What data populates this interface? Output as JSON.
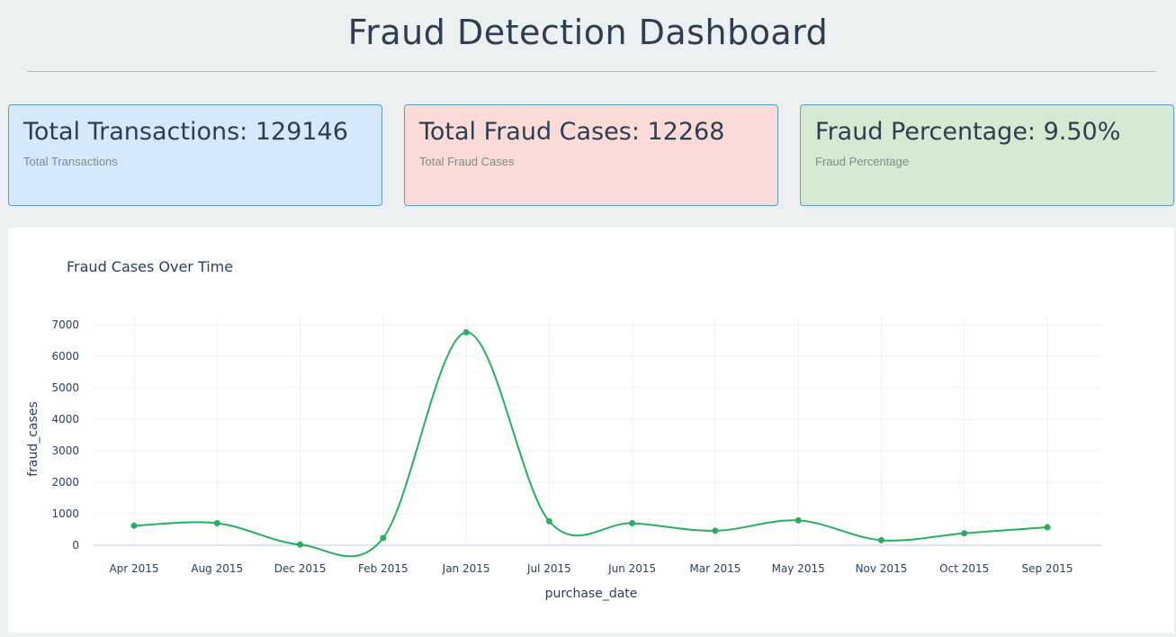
{
  "header": {
    "title": "Fraud Detection Dashboard"
  },
  "cards": [
    {
      "value_text": "Total Transactions: 129146",
      "subtitle": "Total Transactions"
    },
    {
      "value_text": "Total Fraud Cases: 12268",
      "subtitle": "Total Fraud Cases"
    },
    {
      "value_text": "Fraud Percentage: 9.50%",
      "subtitle": "Fraud Percentage"
    }
  ],
  "colors": {
    "line": "#27ae60",
    "card_blue": "#d6e8fb",
    "card_red": "#fadbd8",
    "card_green": "#d5e9d3"
  },
  "chart_data": {
    "type": "line",
    "title": "Fraud Cases Over Time",
    "xlabel": "purchase_date",
    "ylabel": "fraud_cases",
    "categories": [
      "Apr 2015",
      "Aug 2015",
      "Dec 2015",
      "Feb 2015",
      "Jan 2015",
      "Jul 2015",
      "Jun 2015",
      "Mar 2015",
      "May 2015",
      "Nov 2015",
      "Oct 2015",
      "Sep 2015"
    ],
    "values": [
      620,
      700,
      20,
      230,
      6760,
      760,
      700,
      460,
      790,
      160,
      380,
      570
    ],
    "yticks": [
      0,
      1000,
      2000,
      3000,
      4000,
      5000,
      6000,
      7000
    ],
    "ylim": [
      0,
      7000
    ],
    "grid": true,
    "line_shape": "spline",
    "markers": true
  }
}
